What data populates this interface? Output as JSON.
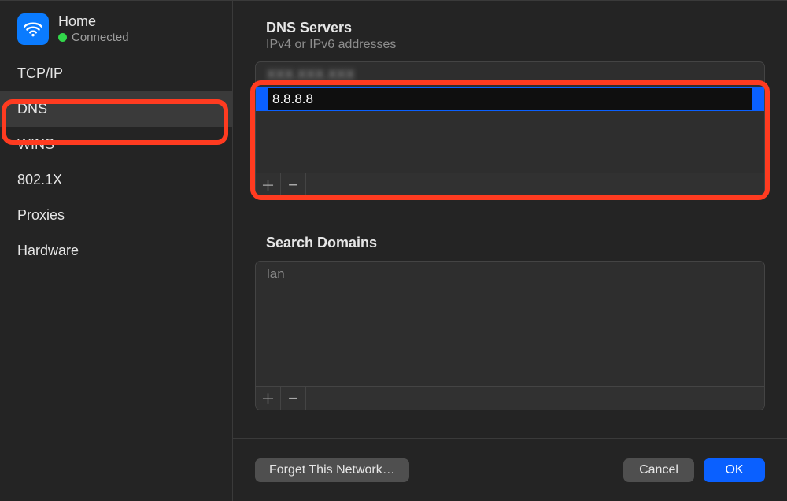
{
  "network": {
    "name": "Home",
    "status": "Connected"
  },
  "sidebar": {
    "items": [
      "TCP/IP",
      "DNS",
      "WINS",
      "802.1X",
      "Proxies",
      "Hardware"
    ],
    "selectedIndex": 1
  },
  "dns": {
    "title": "DNS Servers",
    "subtitle": "IPv4 or IPv6 addresses",
    "rows": [
      {
        "value": "XXX.XXX.XXX",
        "blurred": true,
        "editing": false
      },
      {
        "value": "8.8.8.8",
        "blurred": false,
        "editing": true
      }
    ],
    "addLabel": "＋",
    "removeLabel": "−"
  },
  "searchDomains": {
    "title": "Search Domains",
    "rows": [
      "lan"
    ],
    "addLabel": "＋",
    "removeLabel": "−"
  },
  "footer": {
    "forget": "Forget This Network…",
    "cancel": "Cancel",
    "ok": "OK"
  }
}
